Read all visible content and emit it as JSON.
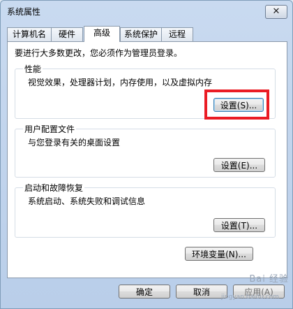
{
  "window": {
    "title": "系统属性",
    "close_label": "✕"
  },
  "tabs": [
    {
      "label": "计算机名"
    },
    {
      "label": "硬件"
    },
    {
      "label": "高级",
      "active": true
    },
    {
      "label": "系统保护"
    },
    {
      "label": "远程"
    }
  ],
  "notice": "要进行大多数更改，您必须作为管理员登录。",
  "performance": {
    "title": "性能",
    "description": "视觉效果，处理器计划，内存使用，以及虚拟内存",
    "button": "设置(S)..."
  },
  "user_profiles": {
    "title": "用户配置文件",
    "description": "与您登录有关的桌面设置",
    "button": "设置(E)..."
  },
  "startup_recovery": {
    "title": "启动和故障恢复",
    "description": "系统启动、系统失败和调试信息",
    "button": "设置(T)..."
  },
  "env_button": "环境变量(N)...",
  "footer": {
    "ok": "确定",
    "cancel": "取消",
    "apply": "应用(A)"
  },
  "annotation_color": "#ea1c24",
  "watermark": "Bai 经验",
  "watermark_sub": "jingyan.baidu.com"
}
